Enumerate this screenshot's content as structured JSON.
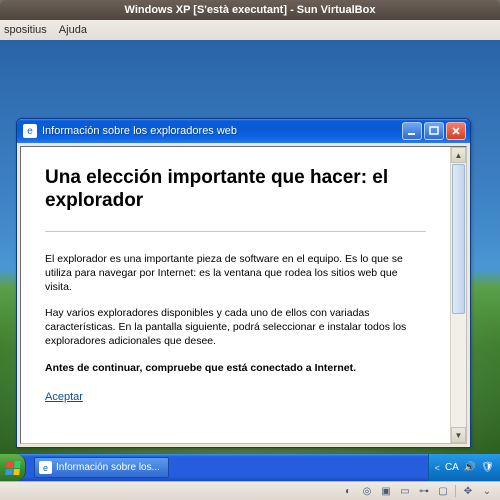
{
  "host": {
    "title": "Windows XP [S'està executant] - Sun VirtualBox",
    "menu": {
      "dispositius": "spositius",
      "ajuda": "Ajuda"
    },
    "status_icons": [
      "disk-icon",
      "cd-icon",
      "folder-icon",
      "network-icon",
      "usb-icon",
      "monitor-icon",
      "mouse-icon"
    ]
  },
  "xp_window": {
    "title": "Información sobre los exploradores web",
    "heading": "Una elección importante que hacer: el explorador",
    "para1": "El explorador es una importante pieza de software en el equipo. Es lo que se utiliza para navegar por Internet: es la ventana que rodea los sitios web que visita.",
    "para2": "Hay varios exploradores disponibles y cada uno de ellos con variadas características. En la pantalla siguiente, podrá seleccionar e instalar todos los exploradores adicionales que desee.",
    "para3_bold": "Antes de continuar, compruebe que está conectado a Internet.",
    "accept_link": "Aceptar"
  },
  "taskbar": {
    "task_label": "Información sobre los...",
    "tray_lang": "CA"
  }
}
